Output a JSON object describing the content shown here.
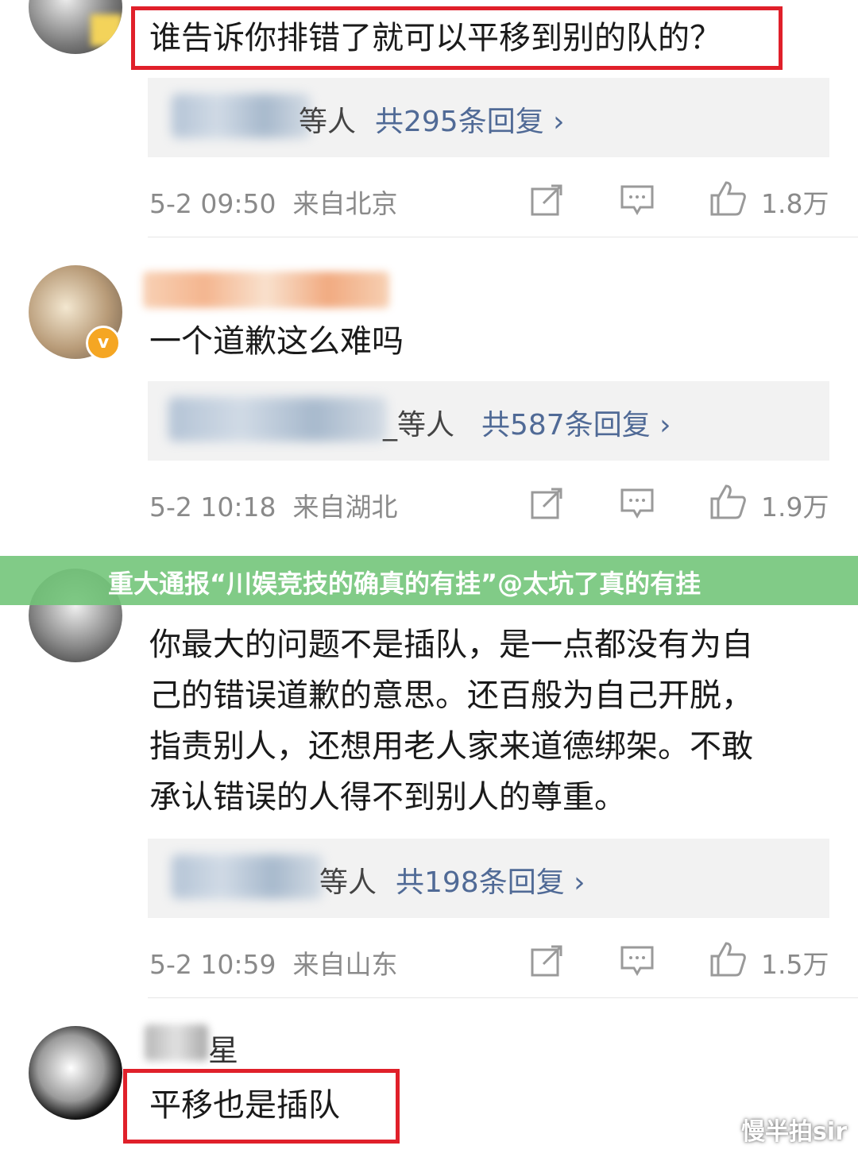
{
  "comments": [
    {
      "text": "谁告诉你排错了就可以平移到别的队的？",
      "reply_suffix": "等人",
      "reply_count": "共295条回复 ›",
      "time": "5-2 09:50",
      "location": "来自北京",
      "likes": "1.8万"
    },
    {
      "text": "一个道歉这么难吗",
      "reply_suffix": "_等人",
      "reply_count": "共587条回复 ›",
      "time": "5-2 10:18",
      "location": "来自湖北",
      "likes": "1.9万",
      "verified_badge": "v"
    },
    {
      "text_lines": [
        "你最大的问题不是插队，是一点都没有为自",
        "己的错误道歉的意思。还百般为自己开脱，",
        "指责别人，还想用老人家来道德绑架。不敢",
        "承认错误的人得不到别人的尊重。"
      ],
      "reply_suffix": "等人",
      "reply_count": "共198条回复 ›",
      "time": "5-2 10:59",
      "location": "来自山东",
      "likes": "1.5万"
    },
    {
      "name_tail": "星",
      "text": "平移也是插队"
    }
  ],
  "banner": {
    "text": "重大通报“川娱竞技的确真的有挂”@太坑了真的有挂"
  },
  "watermark": "慢半拍sir",
  "icons": [
    "share-icon",
    "comment-icon",
    "like-icon"
  ],
  "colors": {
    "highlight_box": "#e0202a",
    "banner": "#70c476",
    "reply_link": "#506a96",
    "meta": "#8a8a8a"
  }
}
